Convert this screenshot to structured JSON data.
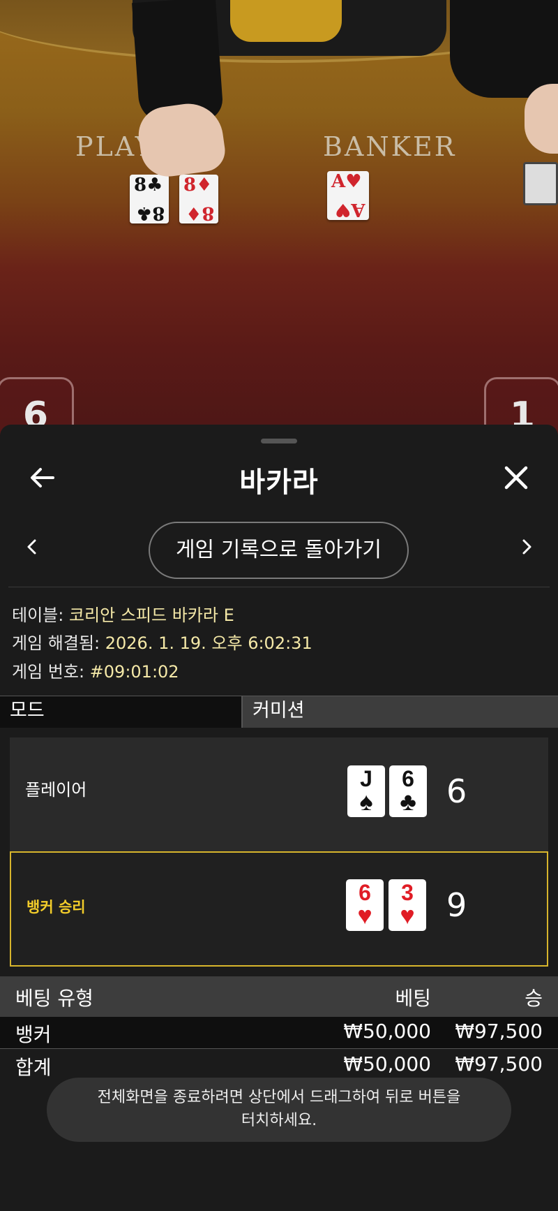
{
  "video": {
    "player_label": "PLAYER",
    "banker_label": "BANKER",
    "player_cards": [
      {
        "rank": "8",
        "suit": "♣",
        "color": "black"
      },
      {
        "rank": "8",
        "suit": "♦",
        "color": "red"
      }
    ],
    "banker_cards": [
      {
        "rank": "A",
        "suit": "♥",
        "color": "red"
      }
    ],
    "player_score": "6",
    "banker_score": "1"
  },
  "header": {
    "title": "바카라",
    "back_icon": "arrow-left-icon",
    "close_icon": "close-icon"
  },
  "history": {
    "prev_icon": "chevron-left-icon",
    "next_icon": "chevron-right-icon",
    "button_label": "게임 기록으로 돌아가기"
  },
  "info": {
    "table_label": "테이블: ",
    "table_value": "코리안 스피드 바카라 E",
    "resolved_label": "게임 해결됨: ",
    "resolved_value": "2026. 1. 19. 오후 6:02:31",
    "game_no_label": "게임 번호: ",
    "game_no_value": "#09:01:02"
  },
  "mode": {
    "label": "모드",
    "value": "커미션"
  },
  "results": {
    "player": {
      "label": "플레이어",
      "cards": [
        {
          "rank": "J",
          "suit": "♠",
          "color": "black"
        },
        {
          "rank": "6",
          "suit": "♣",
          "color": "black"
        }
      ],
      "score": "6"
    },
    "banker": {
      "label": "뱅커 승리",
      "cards": [
        {
          "rank": "6",
          "suit": "♥",
          "color": "red"
        },
        {
          "rank": "3",
          "suit": "♥",
          "color": "red"
        }
      ],
      "score": "9"
    }
  },
  "bets": {
    "headers": {
      "type": "베팅 유형",
      "bet": "베팅",
      "win": "승"
    },
    "rows": [
      {
        "type": "뱅커",
        "bet": "₩50,000",
        "win": "₩97,500"
      }
    ],
    "total": {
      "type": "합계",
      "bet": "₩50,000",
      "win": "₩97,500"
    }
  },
  "toast": {
    "line1": "전체화면을 종료하려면 상단에서 드래그하여 뒤로 버튼을",
    "line2": "터치하세요."
  },
  "colors": {
    "accent_gold": "#f2cc2a",
    "value_yellow": "#f5e9a8",
    "card_red": "#e01c25"
  }
}
